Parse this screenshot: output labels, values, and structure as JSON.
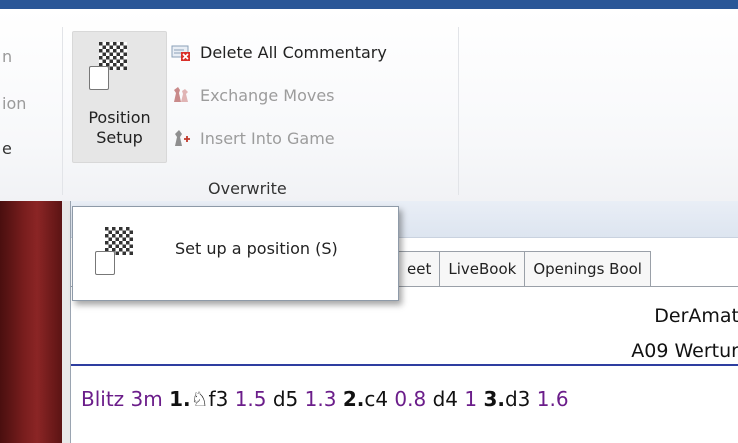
{
  "ribbon": {
    "left_fragments": [
      "n",
      "ion",
      "e"
    ],
    "position_setup_label_1": "Position",
    "position_setup_label_2": "Setup",
    "commands": [
      {
        "label": "Delete All Commentary",
        "enabled": true
      },
      {
        "label": "Exchange Moves",
        "enabled": false
      },
      {
        "label": "Insert Into Game",
        "enabled": false
      }
    ],
    "group_label": "Overwrite"
  },
  "tooltip": {
    "text": "Set up a position (S)"
  },
  "tabs": [
    "eet",
    "LiveBook",
    "Openings Bool"
  ],
  "game_header": {
    "line1": "DerAmat",
    "line2": "A09 Wertur"
  },
  "moves": {
    "event": "Blitz 3m",
    "items": [
      {
        "num": "1.",
        "move": "♘f3",
        "time": "1.5"
      },
      {
        "num": "",
        "move": "d5",
        "time": "1.3"
      },
      {
        "num": "2.",
        "move": "c4",
        "time": "0.8"
      },
      {
        "num": "",
        "move": "d4",
        "time": "1"
      },
      {
        "num": "3.",
        "move": "d3",
        "time": "1.6"
      }
    ]
  },
  "colors": {
    "title_bar": "#2b5797",
    "time_purple": "#6b1d8a",
    "rule_blue": "#2e3ea0"
  }
}
